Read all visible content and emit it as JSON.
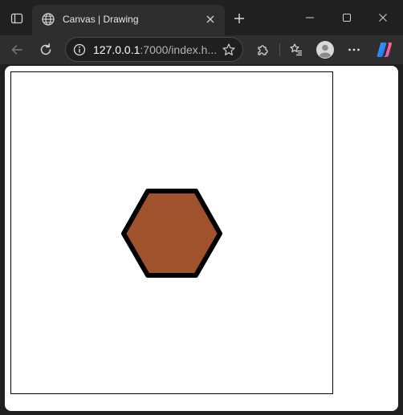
{
  "tab": {
    "title": "Canvas | Drawing"
  },
  "address_bar": {
    "host": "127.0.0.1",
    "rest": ":7000/index.h..."
  },
  "canvas": {
    "shape": "hexagon",
    "fill_color": "#a0522d",
    "stroke_color": "#000000"
  },
  "icons": {
    "tab_actions": "tab-actions-icon",
    "favicon": "globe-icon",
    "close_tab": "close-icon",
    "new_tab": "plus-icon",
    "minimize": "minimize-icon",
    "maximize": "maximize-icon",
    "close_window": "close-icon",
    "back": "back-arrow-icon",
    "refresh": "refresh-icon",
    "site_info": "info-icon",
    "favorite": "star-icon",
    "extensions": "puzzle-icon",
    "favorites": "favorites-list-icon",
    "profile": "avatar-icon",
    "more": "ellipsis-icon",
    "copilot": "copilot-icon"
  }
}
